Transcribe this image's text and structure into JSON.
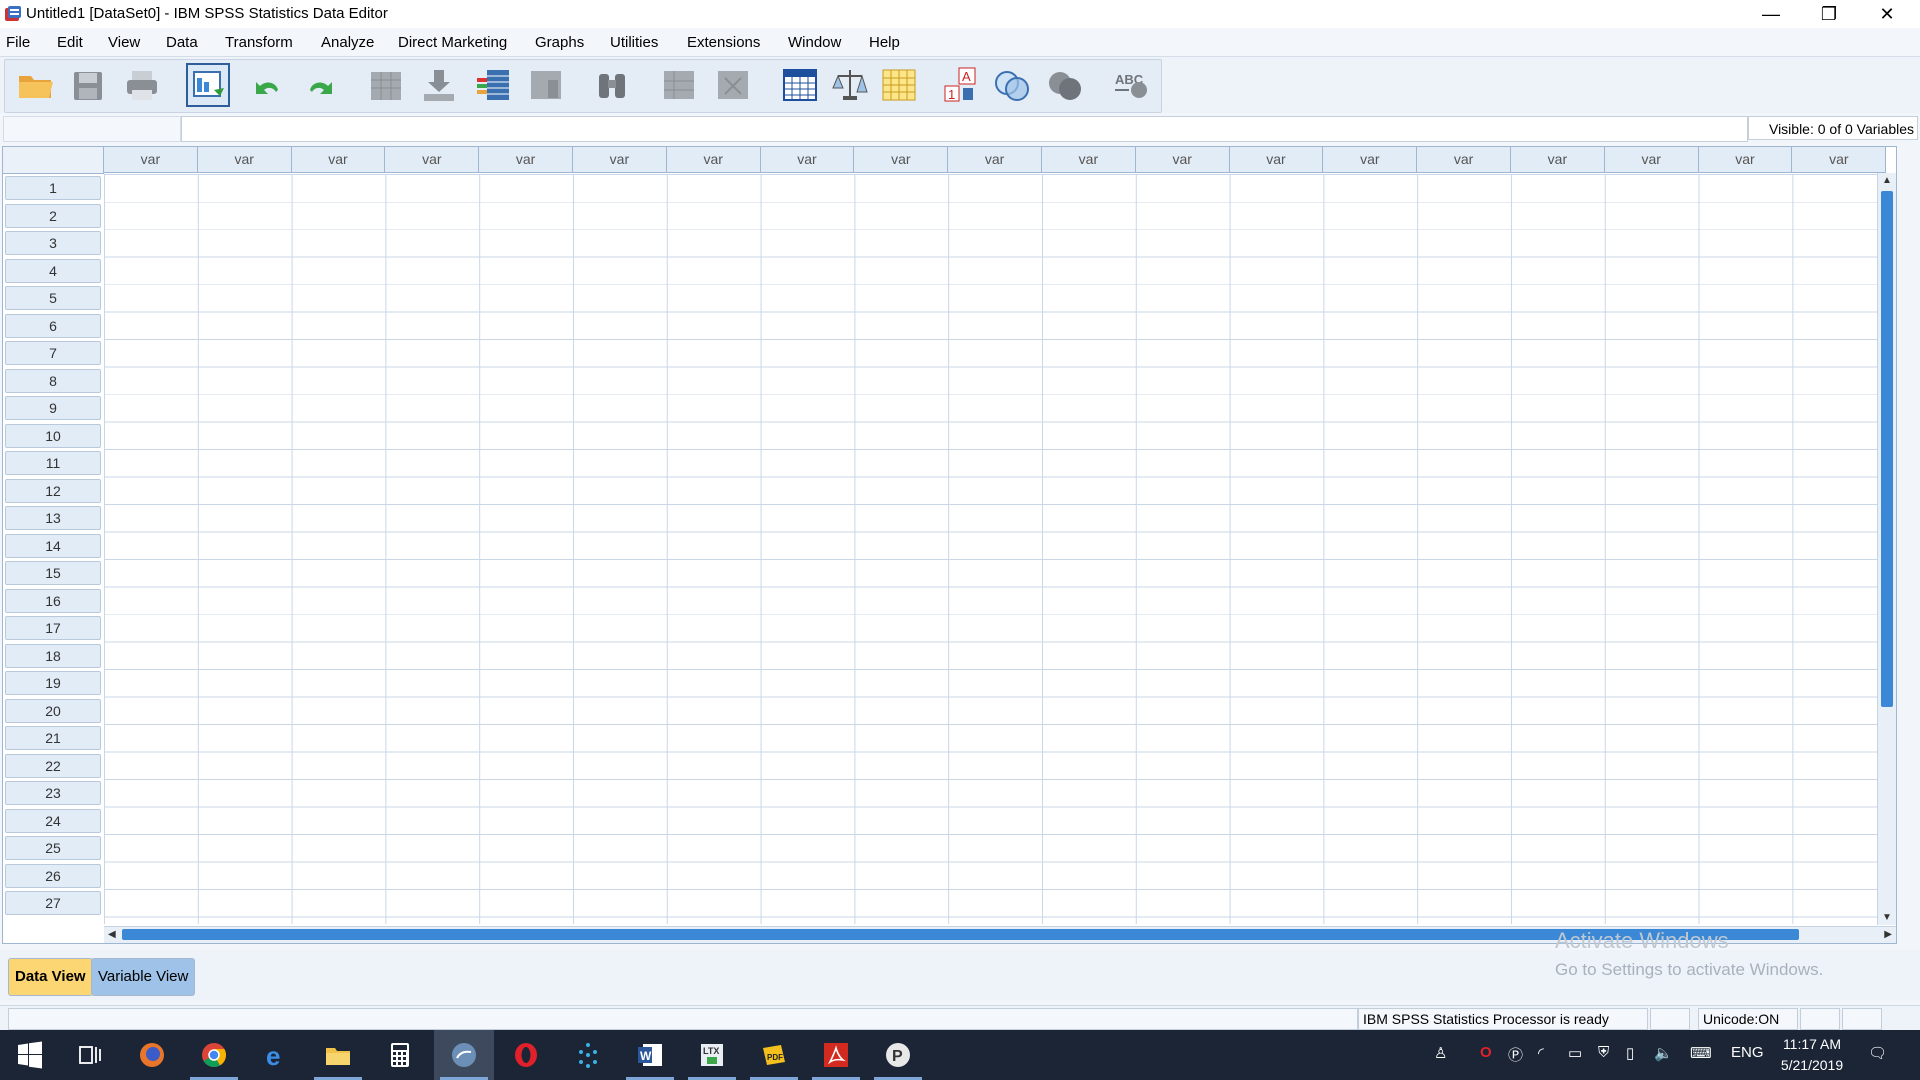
{
  "window": {
    "title": "Untitled1 [DataSet0] - IBM SPSS Statistics Data Editor",
    "minimize_glyph": "—",
    "restore_glyph": "❐",
    "close_glyph": "✕"
  },
  "menu": [
    "File",
    "Edit",
    "View",
    "Data",
    "Transform",
    "Analyze",
    "Direct Marketing",
    "Graphs",
    "Utilities",
    "Extensions",
    "Window",
    "Help"
  ],
  "toolbar": {
    "icons": [
      "open-folder-icon",
      "save-icon",
      "print-icon",
      "dialog-recall-icon",
      "undo-icon",
      "redo-icon",
      "goto-case-icon",
      "goto-variable-icon",
      "variables-icon",
      "run-descriptive-icon",
      "find-icon",
      "insert-cases-icon",
      "insert-variable-icon",
      "split-file-icon",
      "weight-cases-icon",
      "select-cases-icon",
      "value-labels-icon",
      "use-variable-sets-icon",
      "show-all-variables-icon",
      "spell-check-icon"
    ]
  },
  "editor": {
    "cell_reference": "",
    "cell_value": "",
    "visible_label": "Visible: 0 of 0 Variables"
  },
  "grid": {
    "column_header": "var",
    "column_count": 19,
    "rows": [
      "1",
      "2",
      "3",
      "4",
      "5",
      "6",
      "7",
      "8",
      "9",
      "10",
      "11",
      "12",
      "13",
      "14",
      "15",
      "16",
      "17",
      "18",
      "19",
      "20",
      "21",
      "22",
      "23",
      "24",
      "25",
      "26",
      "27"
    ]
  },
  "tabs": {
    "data_view": "Data View",
    "variable_view": "Variable View"
  },
  "watermark": {
    "line1": "Activate Windows",
    "line2": "Go to Settings to activate Windows."
  },
  "status": {
    "processor": "IBM SPSS Statistics Processor is ready",
    "unicode": "Unicode:ON"
  },
  "taskbar": {
    "apps": [
      "windows-start-icon",
      "task-view-icon",
      "firefox-icon",
      "chrome-icon",
      "edge-icon",
      "file-explorer-icon",
      "calculator-icon",
      "spss-icon",
      "opera-icon",
      "dots-app-icon",
      "word-icon",
      "latex-app-icon",
      "pdf-app-icon",
      "acrobat-icon",
      "p-app-icon"
    ],
    "language": "ENG",
    "time": "11:17 AM",
    "date": "5/21/2019"
  },
  "colors": {
    "accent": "#3a88d6",
    "tab_active": "#fcd672",
    "tab_inactive": "#9fc3e8",
    "taskbar": "#1b2536"
  }
}
